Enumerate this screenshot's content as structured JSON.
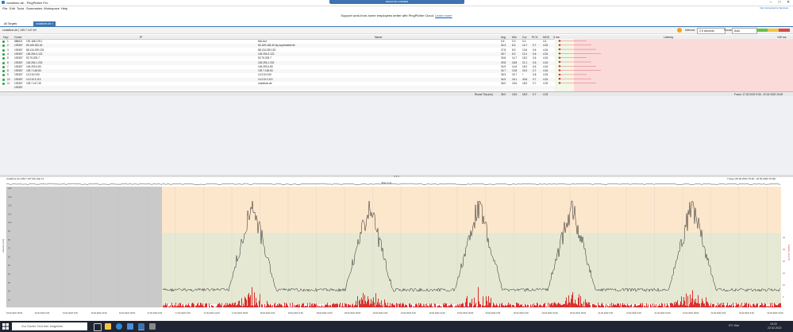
{
  "window": {
    "title": "vodafone.de - PingPlotter Pro",
    "remote_bar": "DESKTOP-1Y8HB6R"
  },
  "menu": [
    "File",
    "Edit",
    "Tools",
    "Summaries",
    "Workspace",
    "Help"
  ],
  "user_link": "Not Connected to Services",
  "banner": {
    "text": "Support work-from-home employees better with PingPlotter Cloud.",
    "link": "Learn more!"
  },
  "tabs": [
    "All Targets",
    "vodafone.de"
  ],
  "crumb": "vodafone.de  |  139.7.147.49",
  "controls": {
    "interval_label": "Interval:",
    "interval_value": "2.5 seconds",
    "focus_label": "Focus:",
    "focus_value": "Auto"
  },
  "columns": [
    "Hop",
    "Count",
    "IP",
    "Name",
    "Avg",
    "Min",
    "Cur",
    "PL%",
    "MOS",
    "0 ms",
    "Latency",
    "140 ms"
  ],
  "hops": [
    {
      "hop": "1",
      "count": "586621",
      "ip": "192.168.178.1",
      "name": "fritz.box",
      "avg": "0.6",
      "min": "0.3",
      "cur": "0.3",
      "pl": "",
      "mos": "4.4",
      "status": "green"
    },
    {
      "hop": "2",
      "count": "193357",
      "ip": "83.169.183.40",
      "name": "83-169-183-40.isp.superkabel.de",
      "avg": "34.3",
      "min": "8.3",
      "cur": "14.7",
      "pl": "0.7",
      "mos": "4.33",
      "status": "green"
    },
    {
      "hop": "3",
      "count": "193357",
      "ip": "88.134.235.133",
      "name": "88.134.235.133",
      "avg": "27.8",
      "min": "8.9",
      "cur": "13.6",
      "pl": "0.6",
      "mos": "4.34",
      "status": "green"
    },
    {
      "hop": "4",
      "count": "193357",
      "ip": "145.254.3.122",
      "name": "145.254.3.122",
      "avg": "28.7",
      "min": "8.3",
      "cur": "13.1",
      "pl": "0.6",
      "mos": "4.34",
      "status": "green"
    },
    {
      "hop": "5",
      "count": "193357",
      "ip": "92.79.209.7",
      "name": "92.79.209.7",
      "avg": "30.8",
      "min": "14.7",
      "cur": "18.2",
      "pl": "0.6",
      "mos": "4.34",
      "status": "green"
    },
    {
      "hop": "6",
      "count": "193357",
      "ip": "145.254.1.202",
      "name": "145.254.1.202",
      "avg": "29.8",
      "min": "18.8",
      "cur": "21.1",
      "pl": "0.6",
      "mos": "4.34",
      "status": "green"
    },
    {
      "hop": "7",
      "count": "193357",
      "ip": "145.253.3.83",
      "name": "145.253.3.83",
      "avg": "34.9",
      "min": "14.6",
      "cur": "18.2",
      "pl": "0.6",
      "mos": "4.34",
      "status": "green"
    },
    {
      "hop": "8",
      "count": "193357",
      "ip": "139.7.148.84",
      "name": "139.7.148.84",
      "avg": "34.7",
      "min": "13.8",
      "cur": "22.0",
      "pl": "0.7",
      "mos": "4.34",
      "status": "green"
    },
    {
      "hop": "9",
      "count": "193357",
      "ip": "10.210.0.50",
      "name": "10.210.0.50",
      "avg": "35.3",
      "min": "15.7",
      "cur": "*",
      "pl": "0.8",
      "mos": "4.33",
      "status": "green"
    },
    {
      "hop": "10",
      "count": "193357",
      "ip": "10.210.3.113",
      "name": "10.210.3.113",
      "avg": "34.9",
      "min": "16.1",
      "cur": "40.8",
      "pl": "0.7",
      "mos": "4.33",
      "status": "green"
    },
    {
      "hop": "11",
      "count": "193357",
      "ip": "139.7.147.49",
      "name": "vodafone.de",
      "avg": "36.0",
      "min": "15.6",
      "cur": "18.9",
      "pl": "0.7",
      "mos": "4.33",
      "status": "green"
    },
    {
      "hop": "",
      "count": "193357",
      "ip": "",
      "name": "",
      "avg": "",
      "min": "",
      "cur": "",
      "pl": "",
      "mos": "",
      "status": "none"
    }
  ],
  "footer": {
    "label": "Round Trip (ms)",
    "avg": "36.0",
    "min": "15.6",
    "cur": "18.9",
    "pl": "0.7",
    "mos": "4.33",
    "focus": "Focus: 17.02.2022 9:06 - 22.02.2022 15:20"
  },
  "graph": {
    "title": "vodafone.de (139.7.147.49) Hop 11",
    "range": "7 days (15.02.2022 15:20 - 22.02.2022 15:20)",
    "top_label": "Jitter (ms)",
    "left_axis": "Latency (ms)",
    "right_axis": "Packet Loss %",
    "time_labels": [
      "15.02.2022 18:00",
      "16.02.2022 0:00",
      "16.02.2022 6:00",
      "16.02.2022 12:00",
      "16.02.2022 18:00",
      "17.02.2022 0:00",
      "17.02.2022 6:00",
      "17.02.2022 12:00",
      "17.02.2022 18:00",
      "18.02.2022 0:00",
      "18.02.2022 6:00",
      "18.02.2022 12:00",
      "18.02.2022 18:00",
      "19.02.2022 0:00",
      "19.02.2022 6:00",
      "19.02.2022 12:00",
      "19.02.2022 18:00",
      "20.02.2022 0:00",
      "20.02.2022 6:00",
      "20.02.2022 12:00",
      "20.02.2022 18:00",
      "21.02.2022 0:00",
      "21.02.2022 6:00",
      "21.02.2022 12:00",
      "21.02.2022 18:00",
      "22.02.2022 0:00",
      "22.02.2022 6:00",
      "22.02.2022 12:00"
    ],
    "y_ticks": [
      "140",
      "130",
      "120",
      "110",
      "100",
      "90",
      "80",
      "70",
      "60",
      "50",
      "40",
      "30",
      "20",
      "10"
    ],
    "pl_ticks": [
      "30",
      "25",
      "20",
      "15",
      "10",
      "5"
    ]
  },
  "taskbar": {
    "search": "Zur Suche Text hier eingeben",
    "weather": "5°C Klar",
    "time": "15:20",
    "date": "22.02.2022"
  },
  "colors": {
    "accent": "#3d73b0",
    "good": "#dff0d4",
    "warn": "#fde7cc",
    "bad": "#f9d4d4",
    "loss": "#d40000"
  }
}
